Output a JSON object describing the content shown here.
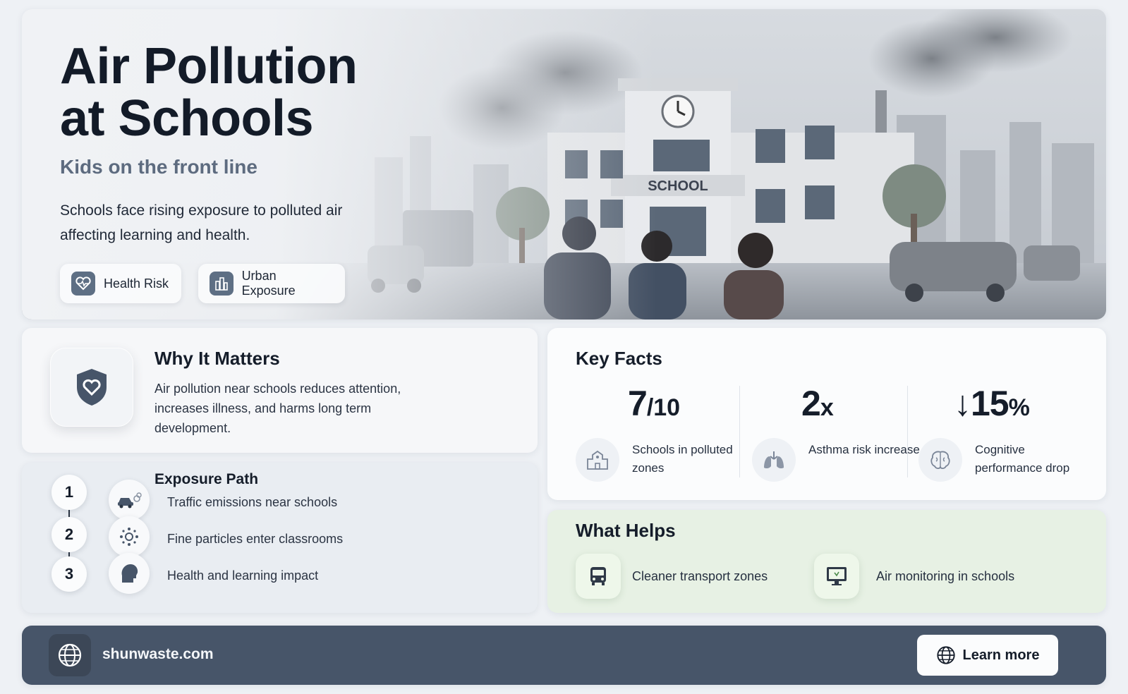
{
  "hero": {
    "title_line1": "Air Pollution",
    "title_line2": "at Schools",
    "subtitle": "Kids on the front line",
    "description": "Schools face rising exposure to polluted air affecting learning and health.",
    "school_sign": "SCHOOL",
    "tags": [
      {
        "label": "Health Risk",
        "icon": "heart-pulse-icon"
      },
      {
        "label": "Urban Exposure",
        "icon": "city-buildings-icon"
      }
    ]
  },
  "why": {
    "title": "Why It Matters",
    "text": "Air pollution near schools reduces attention, increases illness, and harms long term development.",
    "icon": "shield-heart-icon"
  },
  "exposure": {
    "title": "Exposure Path",
    "steps": [
      {
        "number": "1",
        "label": "Traffic emissions near schools",
        "icon": "car-exhaust-icon"
      },
      {
        "number": "2",
        "label": "Fine particles enter classrooms",
        "icon": "particles-icon"
      },
      {
        "number": "3",
        "label": "Health and learning impact",
        "icon": "head-icon"
      }
    ]
  },
  "facts": {
    "title": "Key Facts",
    "items": [
      {
        "value": "7",
        "unit": "/10",
        "label": "Schools in polluted zones",
        "icon": "school-building-icon"
      },
      {
        "value": "2",
        "unit": "x",
        "label": "Asthma risk increase",
        "icon": "lungs-icon"
      },
      {
        "value": "↓15",
        "unit": "%",
        "label": "Cognitive performance drop",
        "icon": "brain-icon"
      }
    ]
  },
  "helps": {
    "title": "What Helps",
    "items": [
      {
        "label": "Cleaner transport zones",
        "icon": "bus-icon"
      },
      {
        "label": "Air monitoring in schools",
        "icon": "monitor-icon"
      }
    ]
  },
  "footer": {
    "site": "shunwaste.com",
    "button_label": "Learn more"
  },
  "colors": {
    "accent": "#475569",
    "help_bg": "#e7f1e4",
    "text_dark": "#151d2a"
  }
}
